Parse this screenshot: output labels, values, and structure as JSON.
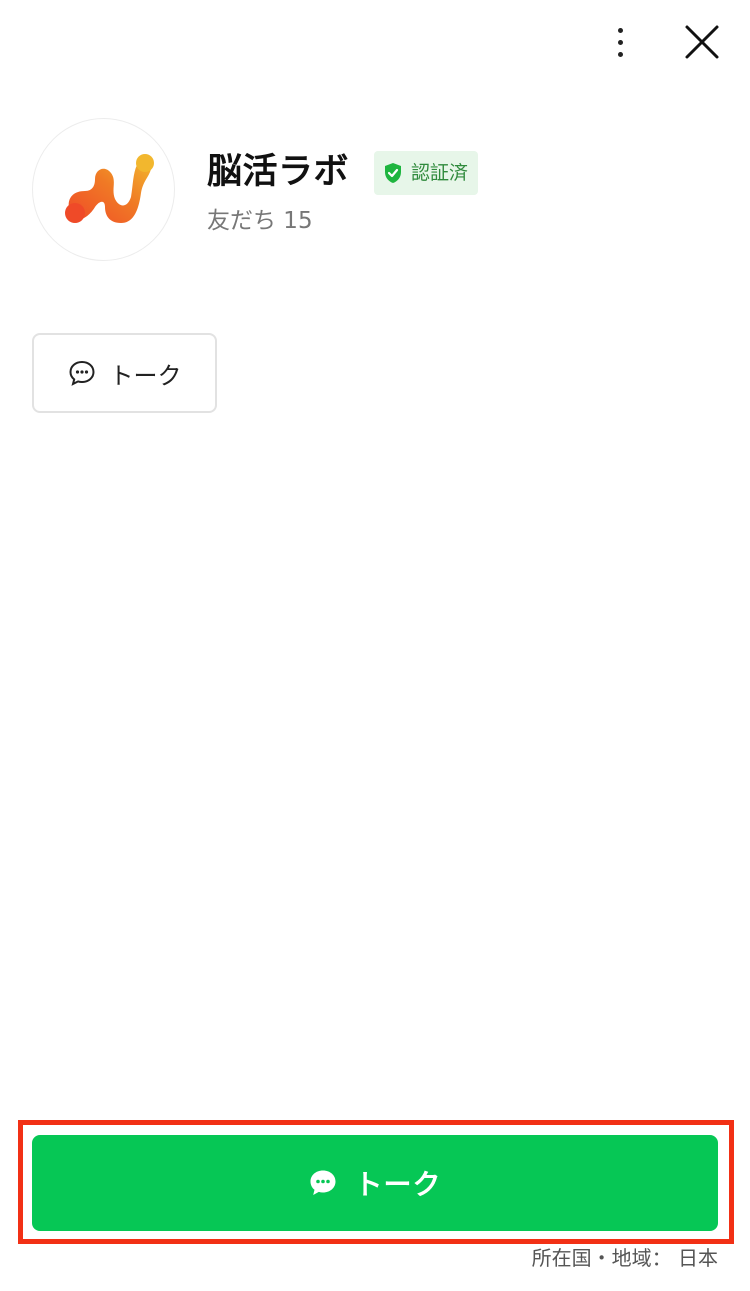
{
  "header": {
    "menu_icon": "more-vertical-icon",
    "close_icon": "close-icon"
  },
  "profile": {
    "logo_icon": "brand-logo-icon",
    "name": "脳活ラボ",
    "verified_label": "認証済",
    "verified_icon": "shield-check-icon",
    "friends_count": "友だち 15"
  },
  "actions": {
    "talk_small_label": "トーク",
    "talk_main_label": "トーク",
    "chat_icon": "chat-bubble-icon"
  },
  "footer": {
    "location": "所在国・地域： 日本"
  },
  "colors": {
    "primary_green": "#06c755",
    "verified_bg": "#e7f6e9",
    "verified_text": "#2f8a3c",
    "highlight": "#f23015"
  }
}
